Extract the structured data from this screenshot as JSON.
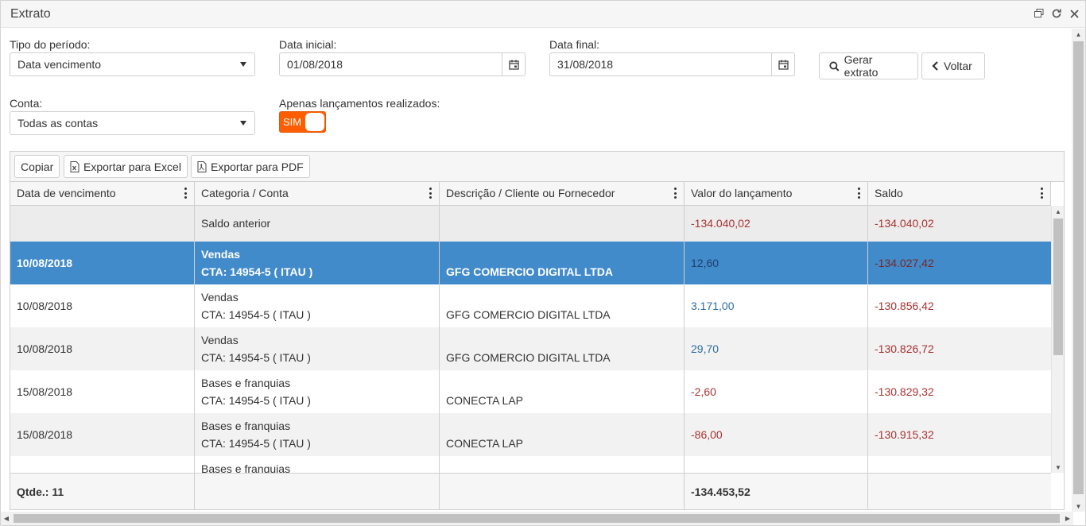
{
  "window": {
    "title": "Extrato"
  },
  "filters": {
    "tipo_periodo": {
      "label": "Tipo do período:",
      "value": "Data vencimento"
    },
    "data_inicial": {
      "label": "Data inicial:",
      "value": "01/08/2018"
    },
    "data_final": {
      "label": "Data final:",
      "value": "31/08/2018"
    },
    "conta": {
      "label": "Conta:",
      "value": "Todas as contas"
    },
    "apenas_realizados": {
      "label": "Apenas lançamentos realizados:",
      "toggle_text": "SIM",
      "on": true
    },
    "gerar_label": "Gerar extrato",
    "voltar_label": "Voltar"
  },
  "grid_toolbar": {
    "copiar": "Copiar",
    "excel": "Exportar para Excel",
    "pdf": "Exportar para PDF"
  },
  "columns": [
    "Data de vencimento",
    "Categoria / Conta",
    "Descrição / Cliente ou Fornecedor",
    "Valor do lançamento",
    "Saldo"
  ],
  "saldo_anterior": {
    "label": "Saldo anterior",
    "valor": "-134.040,02",
    "saldo": "-134.040,02"
  },
  "rows": [
    {
      "data": "10/08/2018",
      "categoria": "Vendas",
      "conta": "CTA: 14954-5 ( ITAU )",
      "descricao": "GFG COMERCIO DIGITAL LTDA",
      "valor": "12,60",
      "saldo": "-134.027,42",
      "selected": true
    },
    {
      "data": "10/08/2018",
      "categoria": "Vendas",
      "conta": "CTA: 14954-5 ( ITAU )",
      "descricao": "GFG COMERCIO DIGITAL LTDA",
      "valor": "3.171,00",
      "saldo": "-130.856,42"
    },
    {
      "data": "10/08/2018",
      "categoria": "Vendas",
      "conta": "CTA: 14954-5 ( ITAU )",
      "descricao": "GFG COMERCIO DIGITAL LTDA",
      "valor": "29,70",
      "saldo": "-130.826,72"
    },
    {
      "data": "15/08/2018",
      "categoria": "Bases e franquias",
      "conta": "CTA: 14954-5 ( ITAU )",
      "descricao": "CONECTA LAP",
      "valor": "-2,60",
      "saldo": "-130.829,32"
    },
    {
      "data": "15/08/2018",
      "categoria": "Bases e franquias",
      "conta": "CTA: 14954-5 ( ITAU )",
      "descricao": "CONECTA LAP",
      "valor": "-86,00",
      "saldo": "-130.915,32"
    },
    {
      "data": "",
      "categoria": "Bases e franquias",
      "conta": "",
      "descricao": "",
      "valor": "",
      "saldo": ""
    }
  ],
  "footer": {
    "qtde": "Qtde.: 11",
    "total": "-134.453,52"
  },
  "colors": {
    "selected_row": "#428bca",
    "toggle_on": "#ff5e00",
    "positive": "#2e6da4",
    "negative": "#a83232"
  }
}
